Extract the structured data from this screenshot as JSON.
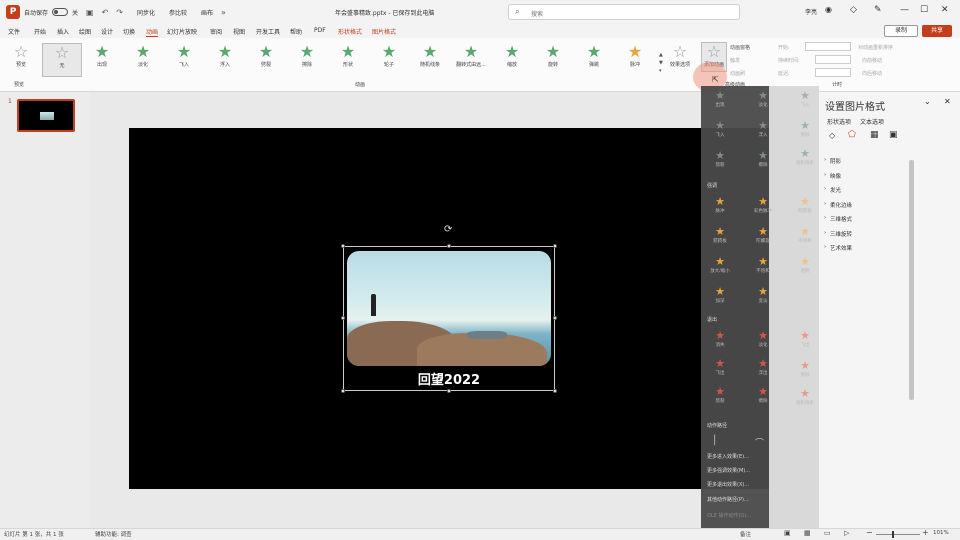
{
  "titlebar": {
    "autosave_label": "自动保存",
    "toggle_state": "关",
    "doc_title": "年会盛事精致.pptx - 已保存到此电脑",
    "search_placeholder": "搜索",
    "user_name": "李亮",
    "qa_items": [
      "同步化",
      "参比较",
      "画布"
    ]
  },
  "tabs": [
    "文件",
    "开始",
    "插入",
    "绘图",
    "设计",
    "切换",
    "动画",
    "幻灯片放映",
    "审阅",
    "视图",
    "开发工具",
    "帮助",
    "PDF",
    "形状格式",
    "图片格式"
  ],
  "active_tab": "动画",
  "context_tabs": [
    "形状格式",
    "图片格式"
  ],
  "record_button": "录制",
  "share_button": "共享",
  "ribbon": {
    "preview_label": "预览",
    "effects": [
      {
        "label": "无",
        "tone": "gray"
      },
      {
        "label": "出现",
        "tone": "green"
      },
      {
        "label": "淡化",
        "tone": "green"
      },
      {
        "label": "飞入",
        "tone": "green"
      },
      {
        "label": "浮入",
        "tone": "green"
      },
      {
        "label": "劈裂",
        "tone": "green"
      },
      {
        "label": "擦除",
        "tone": "green"
      },
      {
        "label": "形状",
        "tone": "green"
      },
      {
        "label": "轮子",
        "tone": "green"
      },
      {
        "label": "随机线条",
        "tone": "green"
      },
      {
        "label": "翻转式由远...",
        "tone": "green"
      },
      {
        "label": "缩放",
        "tone": "green"
      },
      {
        "label": "旋转",
        "tone": "green"
      },
      {
        "label": "弹跳",
        "tone": "green"
      },
      {
        "label": "脉冲",
        "tone": "gold"
      }
    ],
    "effect_options_label": "效果选项",
    "add_animation_label": "添加动画",
    "group_label_animation": "动画",
    "group_label_preview": "预览",
    "group_label_advanced": "高级动画",
    "group_label_timing": "计时",
    "pane_label": "动画窗格",
    "trigger_label": "触发",
    "painter_label": "动画刷",
    "start_label": "开始:",
    "duration_label": "持续时间:",
    "delay_label": "延迟:",
    "reorder_label": "对动画重新排序",
    "move_earlier": "向前移动",
    "move_later": "向后移动"
  },
  "dropdown": {
    "sections": [
      "强调",
      "退出",
      "动作路径"
    ],
    "entrance_items": [
      "出现",
      "淡化",
      "飞入",
      "浮入",
      "劈裂",
      "擦除",
      "形状",
      "轮子",
      "随机线条",
      "翻转式由远...",
      "缩放",
      "旋转",
      "弹跳"
    ],
    "emphasis_items": [
      "脉冲",
      "彩色脉冲",
      "跷跷板",
      "陀螺旋",
      "放大/缩小",
      "不饱和",
      "加深",
      "变淡",
      "透明",
      "对象颜色",
      "补色",
      "线条颜色",
      "填充颜色",
      "画笔颜色",
      "字体颜色",
      "下划线",
      "加粗闪烁",
      "加粗展示",
      "波浪形"
    ],
    "exit_items": [
      "消失",
      "淡化",
      "飞出",
      "浮出",
      "劈裂",
      "擦除",
      "形状",
      "轮子",
      "随机线条",
      "收缩并旋转",
      "缩放",
      "旋转",
      "弹跳"
    ],
    "links": [
      "更多进入效果(E)...",
      "更多强调效果(M)...",
      "更多退出效果(X)...",
      "其他动作路径(P)...",
      "OLE 操作动作(O)..."
    ]
  },
  "format_pane": {
    "title": "设置图片格式",
    "tab_shape": "形状选项",
    "tab_text": "文本选项",
    "rows": [
      "阴影",
      "映像",
      "发光",
      "柔化边缘",
      "三维格式",
      "三维旋转",
      "艺术效果"
    ]
  },
  "slide": {
    "caption": "回望2022",
    "thumb_number": "1"
  },
  "status": {
    "slide_info": "幻灯片 第 1 张，共 1 张",
    "accessibility": "辅助功能: 调查",
    "notes": "备注",
    "zoom": "101%"
  },
  "colors": {
    "accent": "#c43e1c",
    "entrance_green": "#5aa86f",
    "emphasis_gold": "#e8a43c",
    "exit_red": "#d0584a"
  }
}
